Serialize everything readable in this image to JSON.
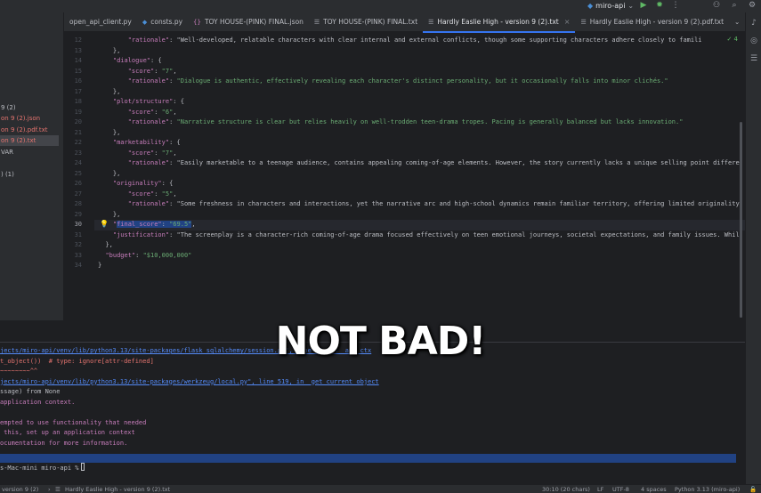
{
  "toolbar": {
    "run_config": "miro-api",
    "colors": {
      "accent": "#3574f0",
      "background": "#1e1f22",
      "panel": "#2b2d30"
    }
  },
  "tabs": [
    {
      "label": "open_api_client.py",
      "icon": "python-file-icon",
      "active": false
    },
    {
      "label": "consts.py",
      "icon": "python-file-icon",
      "active": false
    },
    {
      "label": "TOY HOUSE-(PINK) FINAL.json",
      "icon": "json-file-icon",
      "active": false
    },
    {
      "label": "TOY HOUSE-(PINK) FINAL.txt",
      "icon": "text-file-icon",
      "active": false
    },
    {
      "label": "Hardly Easlie High - version 9 (2).txt",
      "icon": "text-file-icon",
      "active": true
    },
    {
      "label": "Hardly Easlie High - version 9 (2).pdf.txt",
      "icon": "text-file-icon",
      "active": false
    }
  ],
  "project_tree": [
    {
      "label": "9 (2)",
      "color": "#bcbec4",
      "selected": false
    },
    {
      "label": "on 9 (2).json",
      "color": "#e5746f",
      "selected": false
    },
    {
      "label": "on 9 (2).pdf.txt",
      "color": "#e5746f",
      "selected": false
    },
    {
      "label": "on 9 (2).txt",
      "color": "#e5746f",
      "selected": true
    },
    {
      "label": "VAR",
      "color": "#bcbec4",
      "selected": false
    },
    {
      "label": ") (1)",
      "color": "#bcbec4",
      "selected": false
    }
  ],
  "editor": {
    "inspection": "✓ 4",
    "line_numbers": [
      "12",
      "13",
      "14",
      "15",
      "16",
      "17",
      "18",
      "19",
      "20",
      "21",
      "22",
      "23",
      "24",
      "25",
      "26",
      "27",
      "28",
      "29",
      "30",
      "31",
      "32",
      "33",
      "34"
    ],
    "current_line": "30",
    "lines": [
      "        \"rationale\": \"Well-developed, relatable characters with clear internal and external conflicts, though some supporting characters adhere closely to famili",
      "    },",
      "    \"dialogue\": {",
      "        \"score\": \"7\",",
      "        \"rationale\": \"Dialogue is authentic, effectively revealing each character's distinct personality, but it occasionally falls into minor clichés.\"",
      "    },",
      "    \"plot/structure\": {",
      "        \"score\": \"6\",",
      "        \"rationale\": \"Narrative structure is clear but relies heavily on well-trodden teen-drama tropes. Pacing is generally balanced but lacks innovation.\"",
      "    },",
      "    \"marketability\": {",
      "        \"score\": \"7\",",
      "        \"rationale\": \"Easily marketable to a teenage audience, contains appealing coming-of-age elements. However, the story currently lacks a unique selling point differe",
      "    },",
      "    \"originality\": {",
      "        \"score\": \"5\",",
      "        \"rationale\": \"Some freshness in characters and interactions, yet the narrative arc and high-school dynamics remain familiar territory, offering limited originality",
      "    },",
      "    \"final_score\": \"69.5\",",
      "    \"justification\": \"The screenplay is a character-rich coming-of-age drama focused effectively on teen emotional journeys, societal expectations, and family issues. Whil",
      "  },",
      "  \"budget\": \"$10,000,000\"",
      "}"
    ]
  },
  "overlay_text": "NOT BAD!",
  "terminal": {
    "lines": [
      {
        "text": "jects/miro-api/venv/lib/python3.13/site-packages/flask_sqlalchemy/session.py\", line 53, in _app_ctx",
        "cls": "tlink"
      },
      {
        "text": "t_object())  # type: ignore[attr-defined]",
        "cls": "tred"
      },
      {
        "text": "~~~~~~~~^^",
        "cls": "tred"
      },
      {
        "text": "jects/miro-api/venv/lib/python3.13/site-packages/werkzeug/local.py\", line 519, in _get_current_object",
        "cls": "tlink"
      },
      {
        "text": "ssage) from None",
        "cls": "tplain"
      },
      {
        "text": "application context.",
        "cls": "tpurple"
      },
      {
        "text": "",
        "cls": "tplain"
      },
      {
        "text": "empted to use functionality that needed",
        "cls": "tpurple"
      },
      {
        "text": " this, set up an application context",
        "cls": "tpurple"
      },
      {
        "text": "ocumentation for more information.",
        "cls": "tpurple"
      }
    ],
    "prompt": "s-Mac-mini miro-api %"
  },
  "statusbar": {
    "breadcrumb_left": "version 9 (2)",
    "breadcrumb_file": "Hardly Easlie High - version 9 (2).txt",
    "position": "30:10 (20 chars)",
    "line_ending": "LF",
    "encoding": "UTF-8",
    "indent": "4 spaces",
    "interpreter": "Python 3.13 (miro-api)"
  }
}
